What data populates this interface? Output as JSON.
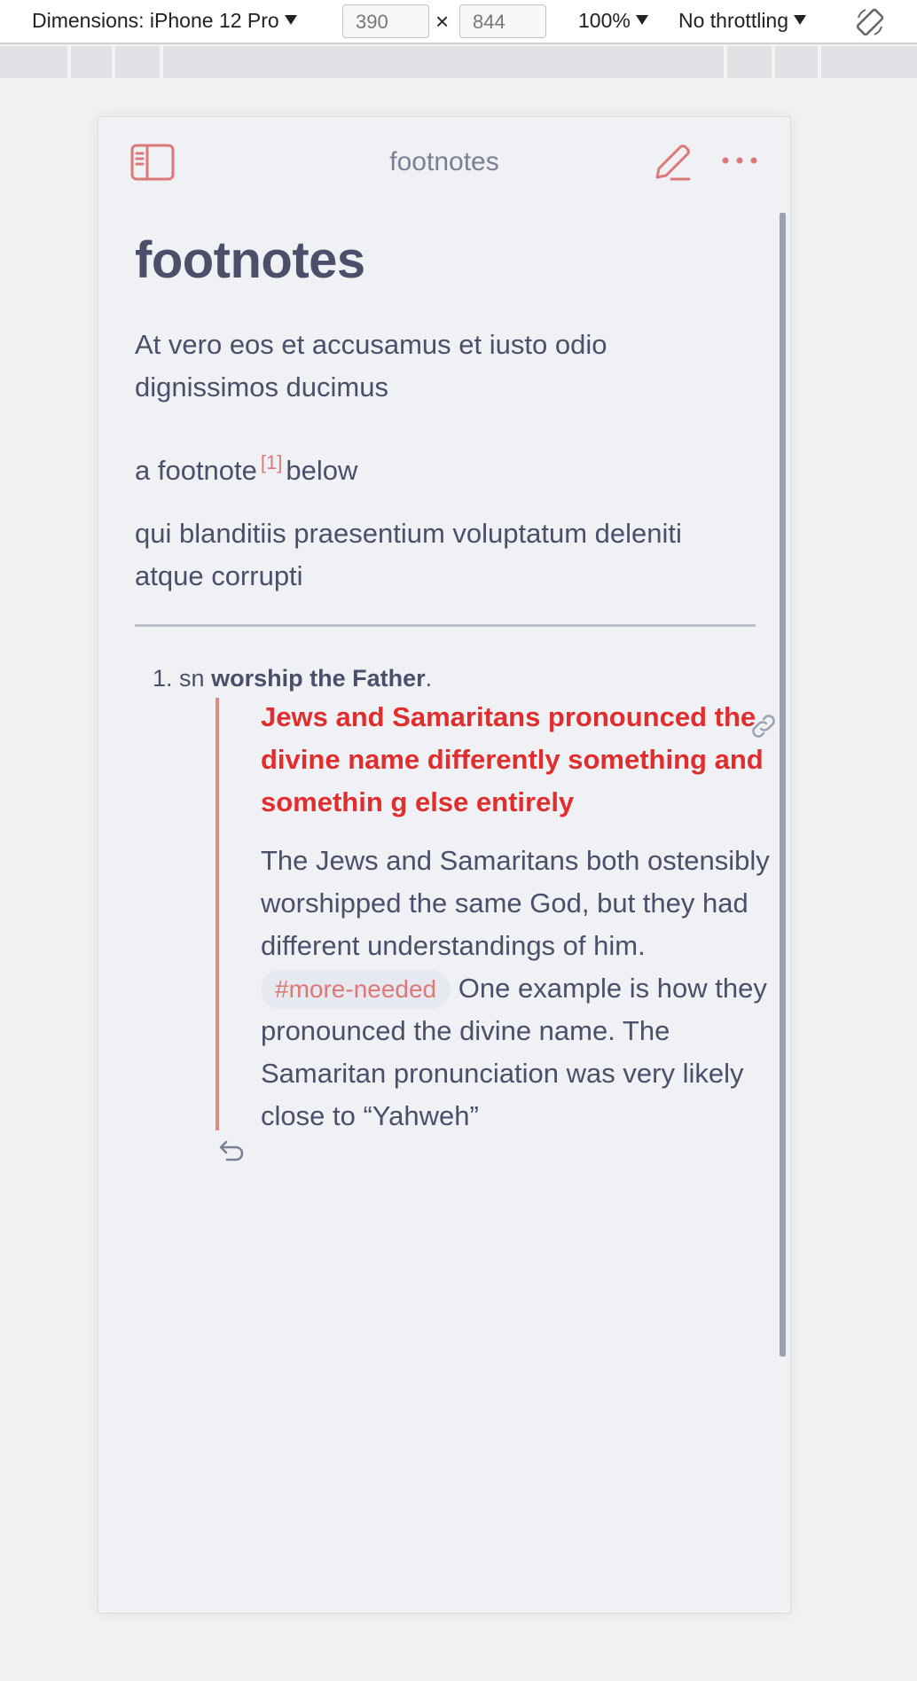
{
  "devtools": {
    "dimensions_label": "Dimensions: iPhone 12 Pro",
    "width_value": "390",
    "height_value": "844",
    "times": "×",
    "zoom": "100%",
    "throttling": "No throttling",
    "rotate_icon": "rotate-icon"
  },
  "topbar": {
    "title": "footnotes",
    "left_icon": "sidebar-toggle-icon",
    "right_icons": [
      "pencil-edit-icon",
      "more-horizontal-icon"
    ]
  },
  "note": {
    "heading": "footnotes",
    "para1": "At vero eos et accusamus et iusto odio dignissimos ducimus",
    "para2_before": "a footnote",
    "para2_ref": "[1]",
    "para2_after": "below",
    "para3": "qui blanditiis praesentium voluptatum deleniti atque corrupti"
  },
  "footnotes": [
    {
      "number": "1.",
      "prefix": "sn",
      "bold": "worship the Father",
      "suffix": ".",
      "callout_title": "Jews and Samaritans pronounced the divine name differently something and somethin g else entirely",
      "body_before": "The Jews and Samaritans both ostensibly worshipped the same God, but they had different understandings of him.",
      "tag": "#more-needed",
      "body_after": "One example is how they pronounced the divine name. The Samaritan pronunciation was very likely close to “Yahweh”",
      "backref_icon": "return-arrow-icon"
    }
  ],
  "colors": {
    "accent": "#dd7878",
    "callout_title": "#e02d2d",
    "text": "#4c4f69",
    "background": "#eff1f5"
  }
}
